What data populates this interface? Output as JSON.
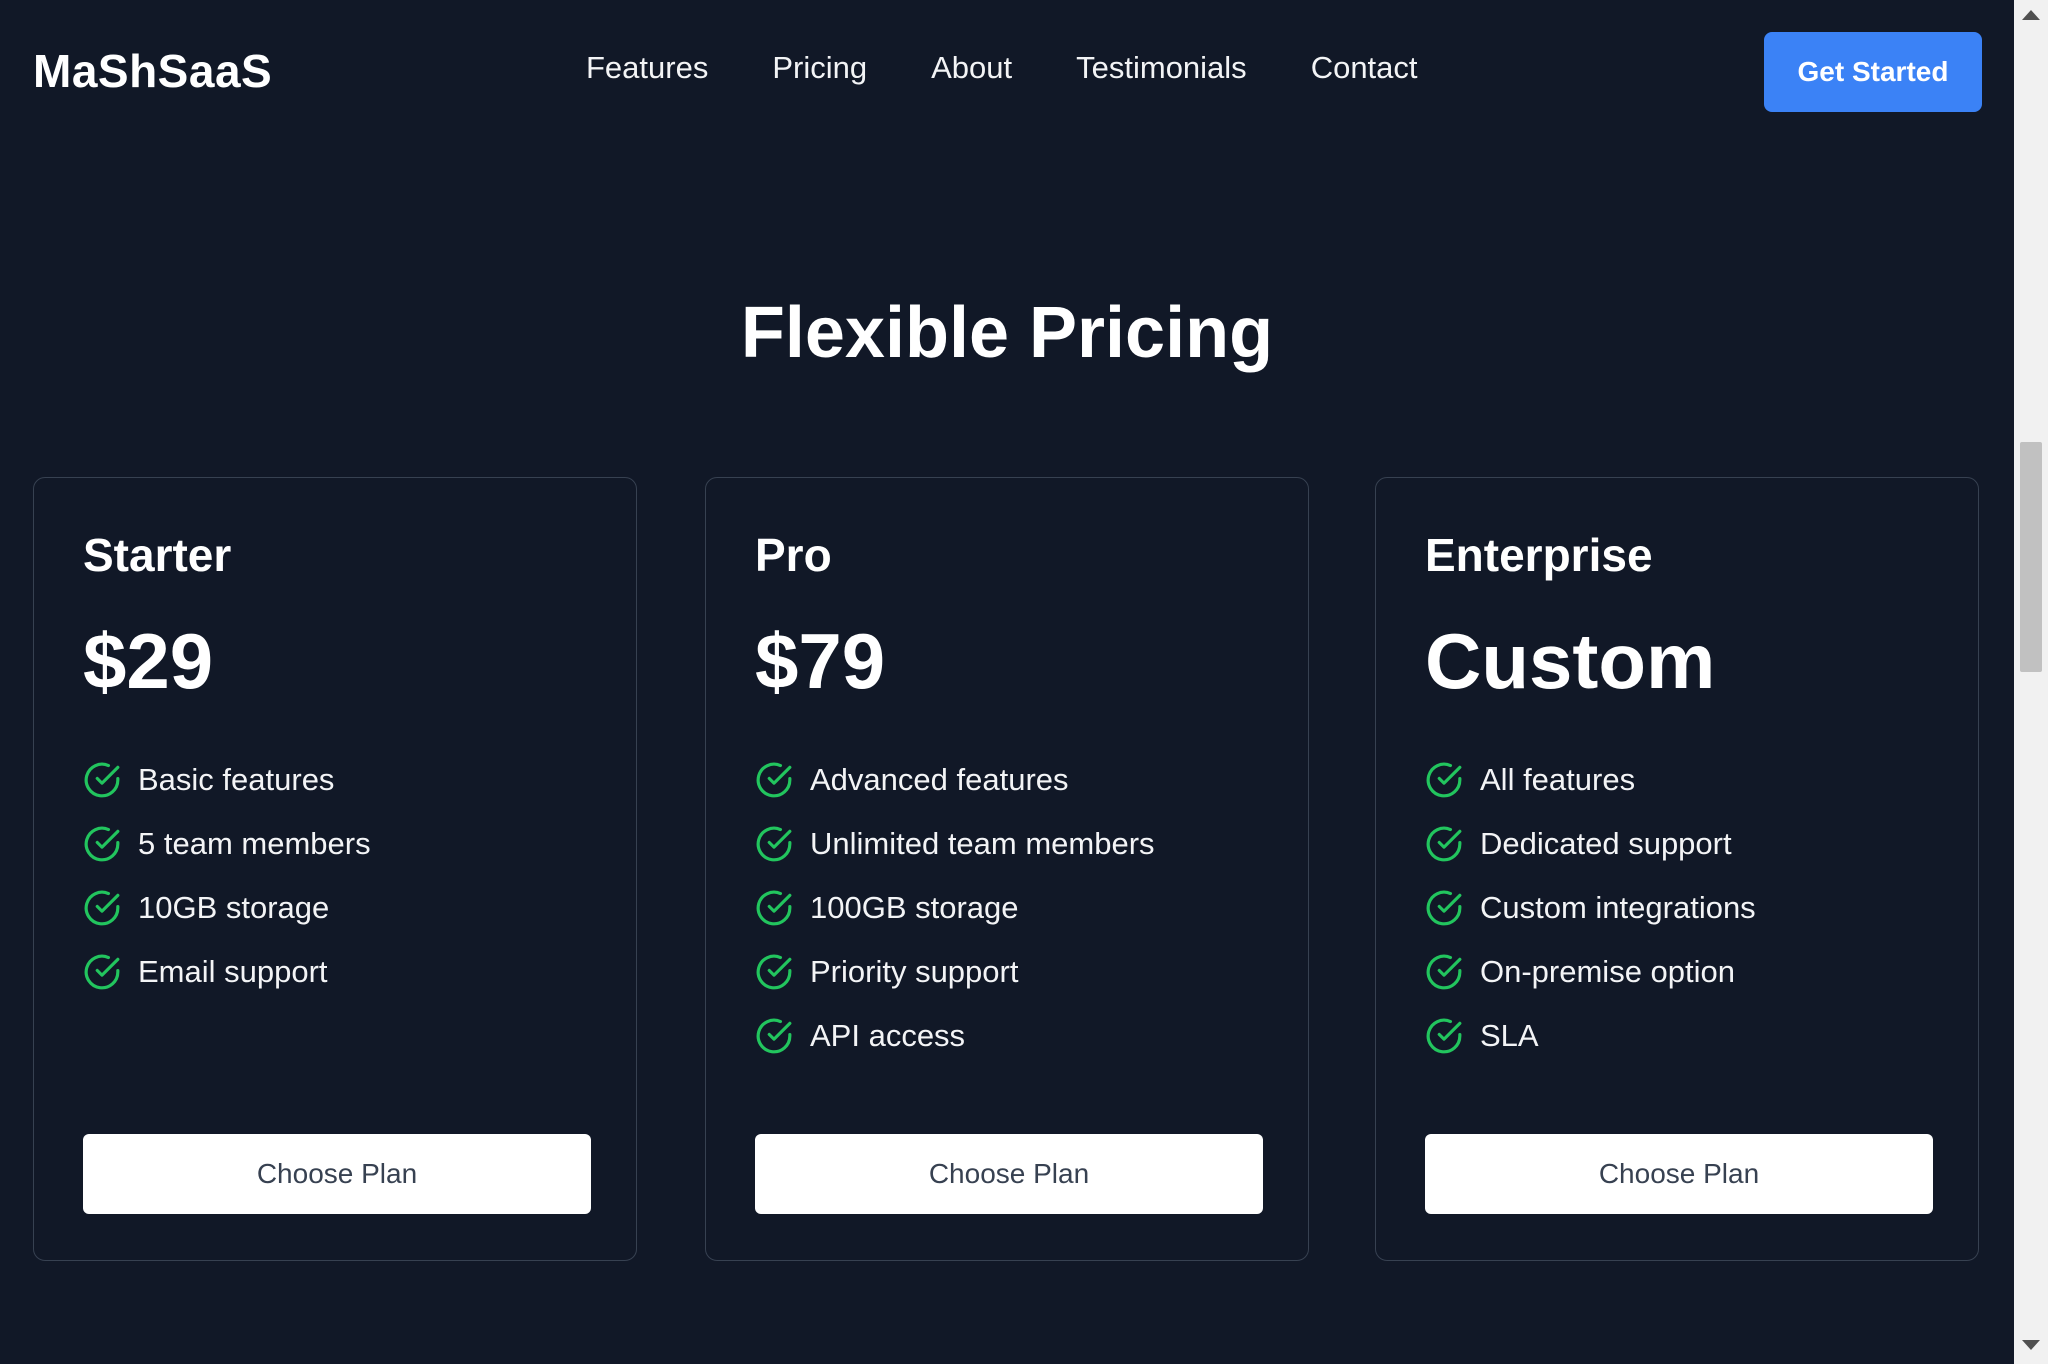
{
  "header": {
    "brand": "MaShSaaS",
    "nav": [
      "Features",
      "Pricing",
      "About",
      "Testimonials",
      "Contact"
    ],
    "cta_label": "Get Started"
  },
  "pricing": {
    "title": "Flexible Pricing",
    "plans": [
      {
        "name": "Starter",
        "price": "$29",
        "features": [
          "Basic features",
          "5 team members",
          "10GB storage",
          "Email support"
        ],
        "button_label": "Choose Plan"
      },
      {
        "name": "Pro",
        "price": "$79",
        "features": [
          "Advanced features",
          "Unlimited team members",
          "100GB storage",
          "Priority support",
          "API access"
        ],
        "button_label": "Choose Plan"
      },
      {
        "name": "Enterprise",
        "price": "Custom",
        "features": [
          "All features",
          "Dedicated support",
          "Custom integrations",
          "On-premise option",
          "SLA"
        ],
        "button_label": "Choose Plan"
      }
    ]
  },
  "colors": {
    "background": "#111827",
    "accent": "#3b82f6",
    "check": "#22c55e",
    "card_border": "#374151"
  },
  "icons": {
    "feature_check": "check-circle-icon"
  }
}
